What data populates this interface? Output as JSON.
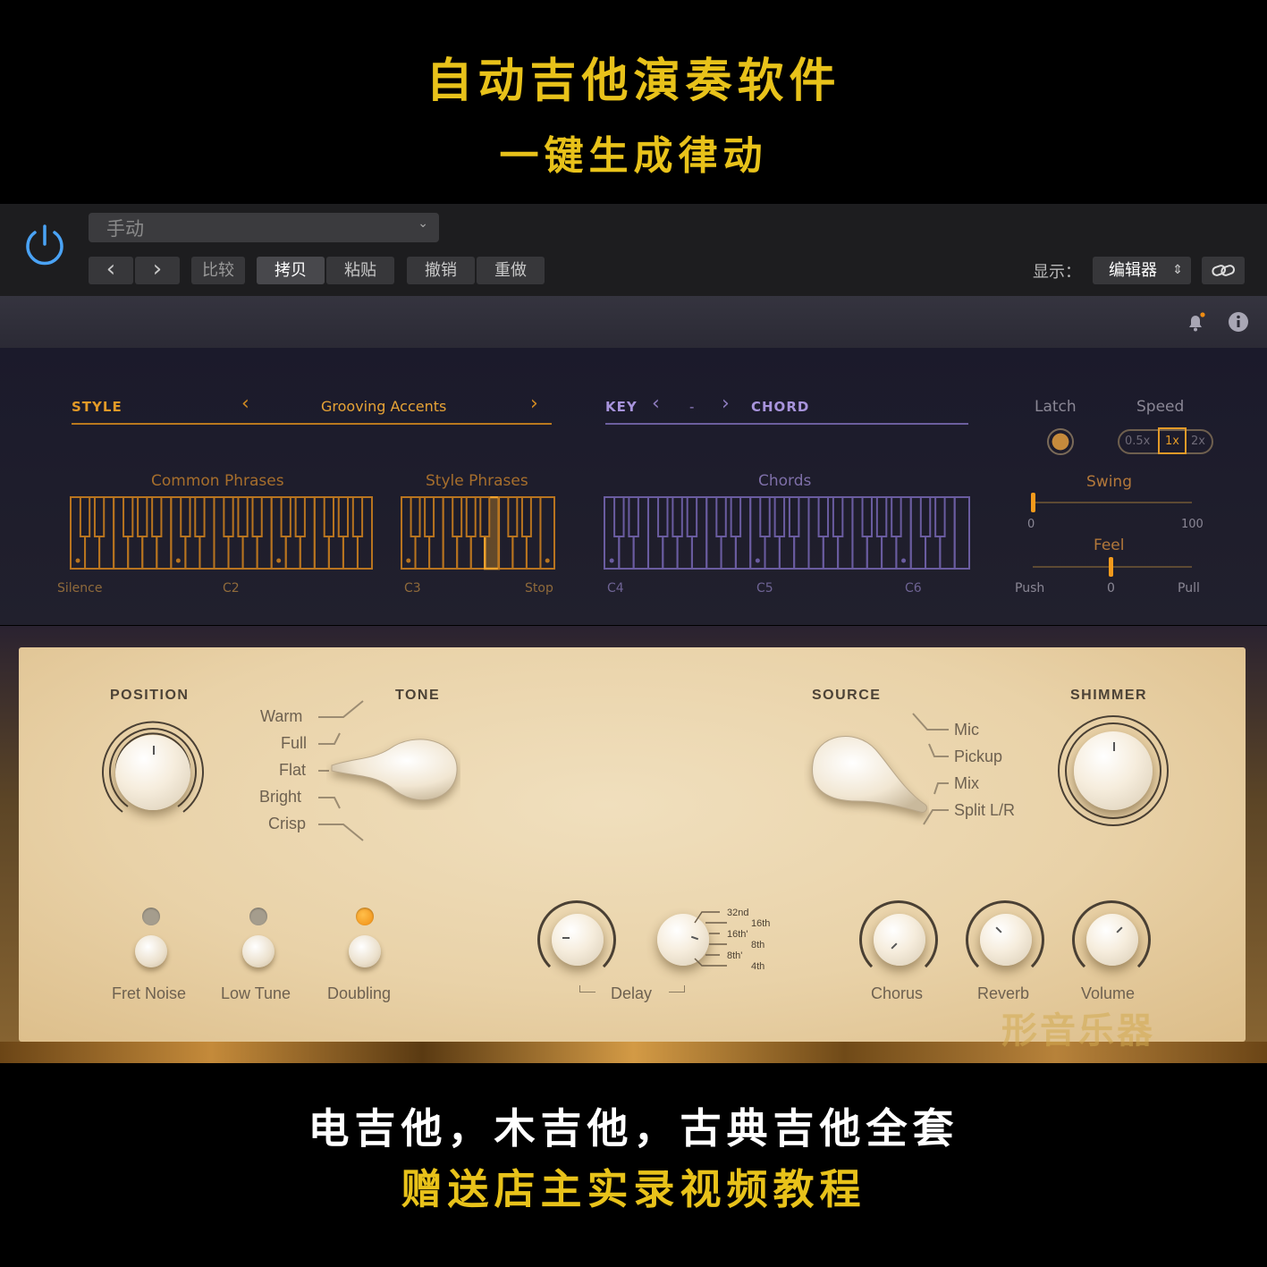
{
  "banner": {
    "title_line1": "自动吉他演奏软件",
    "title_line2": "一键生成律动",
    "bottom_line1": "电吉他，木吉他，古典吉他全套",
    "bottom_line2": "赠送店主实录视频教程"
  },
  "host": {
    "preset_value": "手动",
    "nav_prev": "‹",
    "nav_next": "›",
    "compare": "比较",
    "copy": "拷贝",
    "paste": "粘贴",
    "undo": "撤销",
    "redo": "重做",
    "show_label": "显示：",
    "view_value": "编辑器",
    "icons": [
      "power-icon",
      "chevron-down-icon",
      "link-icon",
      "bell-icon",
      "info-icon"
    ]
  },
  "style": {
    "label": "STYLE",
    "value": "Grooving Accents",
    "prev": "‹",
    "next": "›"
  },
  "key": {
    "label": "KEY",
    "value": "-",
    "prev": "‹",
    "next": "›",
    "chord_label": "CHORD"
  },
  "latch": {
    "label": "Latch"
  },
  "speed": {
    "label": "Speed",
    "options": [
      "0.5x",
      "1x",
      "2x"
    ],
    "selected": "1x"
  },
  "swing": {
    "label": "Swing",
    "min": "0",
    "max": "100",
    "value": 0
  },
  "feel": {
    "label": "Feel",
    "min_label": "Push",
    "mid_label": "0",
    "max_label": "Pull",
    "value": 0
  },
  "keyboards": {
    "common_phrases": "Common Phrases",
    "style_phrases": "Style Phrases",
    "chords": "Chords",
    "labels": [
      "Silence",
      "C2",
      "C3",
      "Stop",
      "C4",
      "C5",
      "C6"
    ]
  },
  "panel": {
    "position": "POSITION",
    "tone": "TONE",
    "tone_options": [
      "Warm",
      "Full",
      "Flat",
      "Bright",
      "Crisp"
    ],
    "tone_selected": "Flat",
    "source": "SOURCE",
    "source_options": [
      "Mic",
      "Pickup",
      "Mix",
      "Split L/R"
    ],
    "source_selected": "Split L/R",
    "shimmer": "SHIMMER",
    "toggles": [
      {
        "label": "Fret Noise",
        "on": false
      },
      {
        "label": "Low Tune",
        "on": false
      },
      {
        "label": "Doubling",
        "on": true
      }
    ],
    "delay": "Delay",
    "delay_divisions": [
      "32nd",
      "16th",
      "16th'",
      "8th",
      "8th'",
      "4th"
    ],
    "chorus": "Chorus",
    "reverb": "Reverb",
    "volume": "Volume",
    "watermark": "形音乐器"
  },
  "colors": {
    "accent_gold": "#e39a28",
    "accent_purple": "#a894dc",
    "led_on": "#f08c12",
    "host_blue": "#4aa3f5"
  }
}
